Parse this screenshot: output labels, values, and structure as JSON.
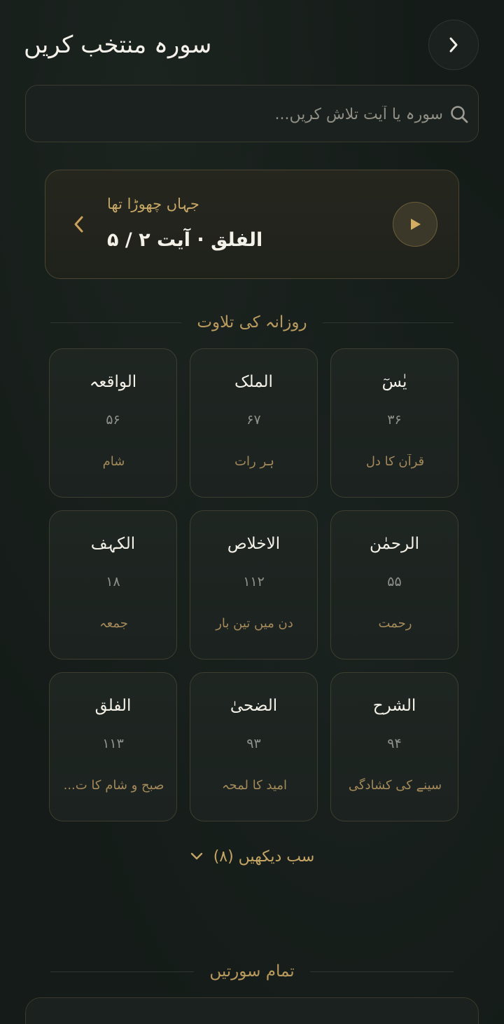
{
  "header": {
    "title": "سورہ منتخب کریں",
    "back_icon": "chevron-right-icon"
  },
  "search": {
    "placeholder": "سورہ یا آیت تلاش کریں...",
    "icon": "search-icon"
  },
  "resume": {
    "label": "جہاں چھوڑا تھا",
    "detail": "الفلق · آیت ۲ / ۵",
    "play_icon": "play-icon",
    "arrow_icon": "chevron-left-icon"
  },
  "daily": {
    "heading": "روزانہ کی تلاوت",
    "items": [
      {
        "name": "یٰسٓ",
        "number": "۳۶",
        "note": "قرآن کا دل"
      },
      {
        "name": "الملک",
        "number": "۶۷",
        "note": "ہر رات"
      },
      {
        "name": "الواقعہ",
        "number": "۵۶",
        "note": "شام"
      },
      {
        "name": "الرحمٰن",
        "number": "۵۵",
        "note": "رحمت"
      },
      {
        "name": "الاخلاص",
        "number": "۱۱۲",
        "note": "دن میں تین بار"
      },
      {
        "name": "الکہف",
        "number": "۱۸",
        "note": "جمعہ"
      },
      {
        "name": "الشرح",
        "number": "۹۴",
        "note": "سینے کی کشادگی"
      },
      {
        "name": "الضحیٰ",
        "number": "۹۳",
        "note": "امید کا لمحہ"
      },
      {
        "name": "الفلق",
        "number": "۱۱۳",
        "note": "صبح و شام کا ت..."
      }
    ],
    "see_all": "سب دیکھیں (۸)",
    "see_all_icon": "chevron-down-icon"
  },
  "all_surahs": {
    "heading": "تمام سورتیں"
  },
  "colors": {
    "background": "#141b18",
    "accent_gold": "#c4a565",
    "card_border": "#3d3e30",
    "text_primary": "#f4f1e8"
  }
}
